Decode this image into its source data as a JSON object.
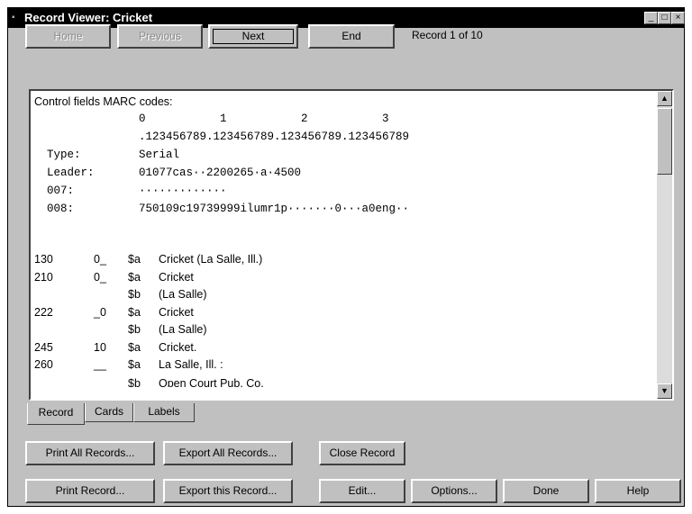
{
  "window": {
    "title": "Record Viewer: Cricket",
    "title_icon": "app-icon",
    "controls": {
      "minimize": "_",
      "maximize": "□",
      "close": "×"
    }
  },
  "nav": {
    "home": "Home",
    "previous": "Previous",
    "next": "Next",
    "end": "End",
    "record_count": "Record 1 of 10"
  },
  "viewer": {
    "header": "Control fields MARC codes:",
    "ruler_numbers": "0           1           2           3",
    "ruler_digits": ".123456789.123456789.123456789.123456789",
    "control_fields": [
      {
        "label": "Type:",
        "value": "Serial"
      },
      {
        "label": "Leader:",
        "value": "01077cas··2200265·a·4500"
      },
      {
        "label": "007:",
        "value": "·············"
      },
      {
        "label": "008:",
        "value": "750109c19739999ilumr1p·······0···a0eng··"
      }
    ],
    "data_fields": [
      {
        "tag": "130",
        "ind": "0_",
        "code": "$a",
        "text": "Cricket (La Salle, Ill.)"
      },
      {
        "tag": "210",
        "ind": "0_",
        "code": "$a",
        "text": "Cricket"
      },
      {
        "tag": "",
        "ind": "",
        "code": "$b",
        "text": "(La Salle)"
      },
      {
        "tag": "222",
        "ind": "_0",
        "code": "$a",
        "text": "Cricket"
      },
      {
        "tag": "",
        "ind": "",
        "code": "$b",
        "text": "(La Salle)"
      },
      {
        "tag": "245",
        "ind": "10",
        "code": "$a",
        "text": "Cricket."
      },
      {
        "tag": "260",
        "ind": "__",
        "code": "$a",
        "text": "La Salle, Ill. :"
      },
      {
        "tag": "",
        "ind": "",
        "code": "$b",
        "text": "Open Court Pub. Co."
      }
    ]
  },
  "tabs": [
    "Record",
    "Cards",
    "Labels"
  ],
  "actions": {
    "print_all": "Print All Records...",
    "export_all": "Export All Records...",
    "close_record": "Close Record",
    "print_record": "Print Record...",
    "export_record": "Export this Record...",
    "edit": "Edit...",
    "options": "Options...",
    "done": "Done",
    "help": "Help"
  }
}
